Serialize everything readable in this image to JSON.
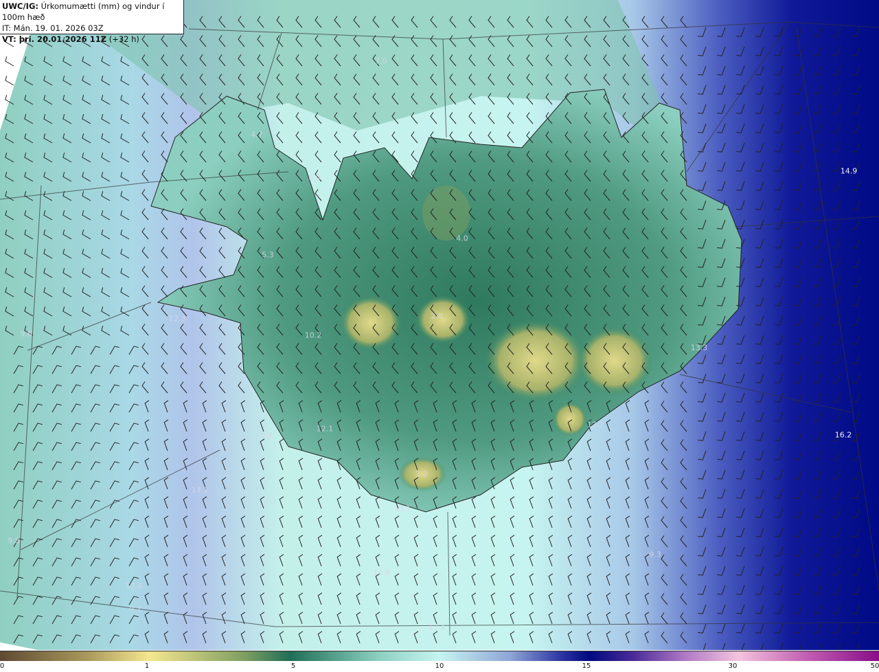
{
  "header": {
    "model": "UWC/IG:",
    "title": "Úrkomumætti (mm) og vindur í 100m hæð",
    "issue_time": "IT: Mán. 19. 01. 2026 03Z",
    "valid_label": "VT: þri. 20.01.2026 11Z",
    "lead_time": "(+32 h)"
  },
  "colorbar": {
    "ticks": [
      "0",
      "1",
      "5",
      "10",
      "15",
      "30",
      "50"
    ],
    "colors": [
      "#5e4a33",
      "#f5e68f",
      "#1f6e57",
      "#c6f4f0",
      "#000a80",
      "#f4c3de",
      "#8a0c8a"
    ]
  },
  "map_values": [
    {
      "text": "7.0"
    },
    {
      "text": "4.7"
    },
    {
      "text": "6.9"
    },
    {
      "text": "14.9"
    },
    {
      "text": "4.0"
    },
    {
      "text": "5.3"
    },
    {
      "text": "12.3"
    },
    {
      "text": "9.6"
    },
    {
      "text": "2.8"
    },
    {
      "text": "10.2"
    },
    {
      "text": "13.3"
    },
    {
      "text": "12.2"
    },
    {
      "text": "6.4"
    },
    {
      "text": "12.1"
    },
    {
      "text": "16.2"
    },
    {
      "text": "3.2"
    },
    {
      "text": "13.1"
    },
    {
      "text": "13.1"
    },
    {
      "text": "9.8"
    },
    {
      "text": "9.3"
    },
    {
      "text": "13.6"
    },
    {
      "text": "12.4"
    },
    {
      "text": "9.7"
    },
    {
      "text": "12.4"
    }
  ]
}
